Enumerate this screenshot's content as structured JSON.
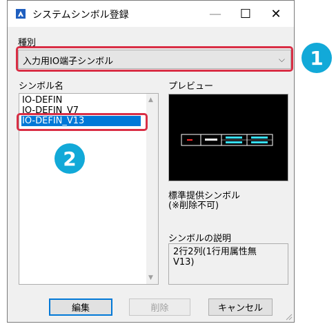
{
  "window": {
    "title": "システムシンボル登録",
    "minimize": "—",
    "maximize": "☐",
    "close": "✕"
  },
  "type_section": {
    "label": "種別",
    "selected": "入力用IO端子シンボル"
  },
  "symbol_list": {
    "label": "シンボル名",
    "items": [
      "IO-DEFIN",
      "IO-DEFIN_V7",
      "IO-DEFIN_V13"
    ],
    "selected_index": 2
  },
  "preview": {
    "label": "プレビュー"
  },
  "standard_note": "標準提供シンボル\n(※削除不可)",
  "description": {
    "label": "シンボルの説明",
    "text": "2行2列(1行用属性無\nV13)"
  },
  "buttons": {
    "edit": "編集",
    "delete": "削除",
    "cancel": "キャンセル"
  },
  "callouts": [
    "1",
    "2"
  ],
  "colors": {
    "callout_red": "#d92e45",
    "badge_blue": "#12a9d8",
    "selection_blue": "#0078d7"
  }
}
